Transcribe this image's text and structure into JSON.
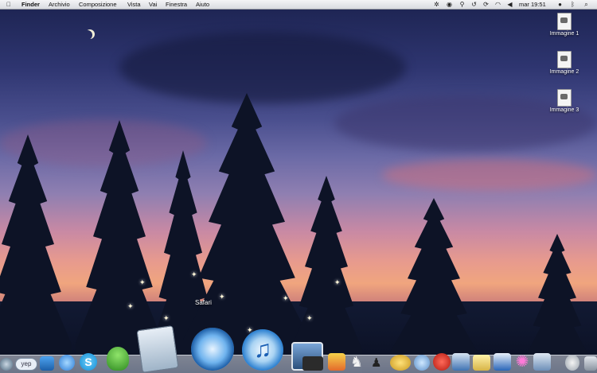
{
  "menubar": {
    "apple_icon": "apple-icon",
    "items": [
      "Finder",
      "Archivio",
      "Composizione",
      "Vista",
      "Vai",
      "Finestra",
      "Aiuto"
    ],
    "clock": "mar 19:51"
  },
  "desktop_icons": [
    {
      "label": "Immagine 1"
    },
    {
      "label": "Immagine 2"
    },
    {
      "label": "Immagine 3"
    }
  ],
  "dock": {
    "tooltip": "Safari",
    "left_badge": "yep",
    "items": [
      "finder-icon",
      "yep-icon",
      "dashboard-icon",
      "app-store-icon",
      "skype-icon",
      "adium-icon",
      "preview-icon",
      "safari-icon",
      "itunes-icon",
      "iphoto-icon",
      "camera-icon",
      "photo-booth-icon",
      "chess-icon",
      "automator-icon",
      "coins-icon",
      "spark-icon",
      "pencil-icon",
      "mail-icon",
      "notes-icon",
      "calendar-icon",
      "star-icon",
      "image-capture-icon",
      "tool-icon",
      "trash-icon"
    ]
  }
}
